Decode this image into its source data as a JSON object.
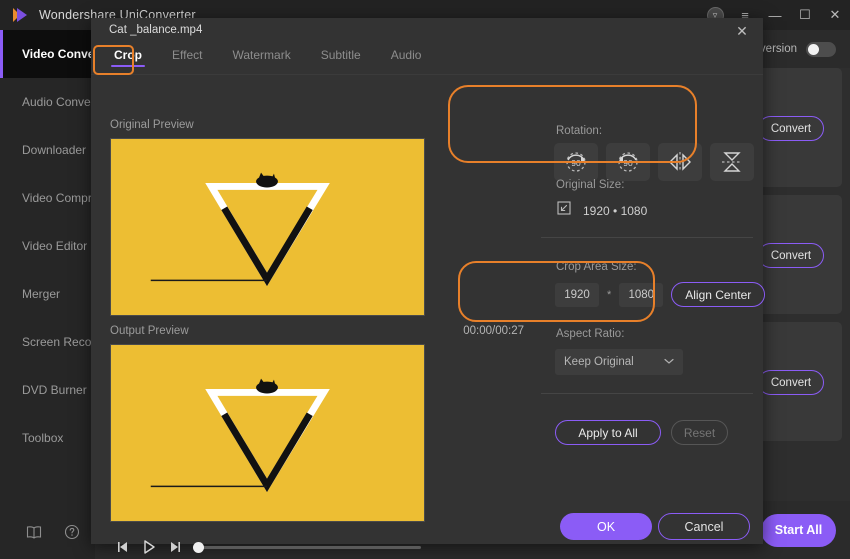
{
  "window": {
    "title": "Wondershare UniConverter",
    "controls": {
      "account": "account-icon",
      "menu": "≡",
      "minimize": "—",
      "maximize": "☐",
      "close": "✕"
    }
  },
  "sidebar": {
    "items": [
      {
        "label": "Video Converter",
        "active": true
      },
      {
        "label": "Audio Converter",
        "active": false
      },
      {
        "label": "Downloader",
        "active": false
      },
      {
        "label": "Video Compressor",
        "active": false
      },
      {
        "label": "Video Editor",
        "active": false
      },
      {
        "label": "Merger",
        "active": false
      },
      {
        "label": "Screen Recorder",
        "active": false
      },
      {
        "label": "DVD Burner",
        "active": false
      },
      {
        "label": "Toolbox",
        "active": false
      }
    ],
    "bottom": {
      "manual_icon": "book-icon",
      "help_icon": "help-icon"
    }
  },
  "main": {
    "merge_label": "Conversion",
    "merge_toggle_on": false,
    "rows": [
      {
        "convert_label": "Convert"
      },
      {
        "convert_label": "Convert"
      },
      {
        "convert_label": "Convert"
      }
    ],
    "start_all_label": "Start All"
  },
  "modal": {
    "file_name": "Cat _balance.mp4",
    "close_label": "✕",
    "tabs": [
      {
        "label": "Crop",
        "active": true
      },
      {
        "label": "Effect",
        "active": false
      },
      {
        "label": "Watermark",
        "active": false
      },
      {
        "label": "Subtitle",
        "active": false
      },
      {
        "label": "Audio",
        "active": false
      }
    ],
    "original_preview_label": "Original Preview",
    "output_preview_label": "Output Preview",
    "output_time": "00:00/00:27",
    "player": {
      "prev_frame_icon": "step-back-icon",
      "play_icon": "play-icon",
      "next_frame_icon": "step-forward-icon",
      "progress_percent": 0
    },
    "rotation": {
      "label": "Rotation:",
      "buttons": [
        {
          "name": "rotate-right-90",
          "text": "90"
        },
        {
          "name": "rotate-left-90",
          "text": "90"
        },
        {
          "name": "flip-horizontal",
          "text": ""
        },
        {
          "name": "flip-vertical",
          "text": ""
        }
      ]
    },
    "original_size": {
      "label": "Original Size:",
      "icon": "resize-icon",
      "value": "1920 • 1080"
    },
    "crop_area": {
      "label": "Crop Area Size:",
      "width": "1920",
      "separator": "*",
      "height": "1080",
      "align_center_label": "Align Center"
    },
    "aspect_ratio": {
      "label": "Aspect Ratio:",
      "selected": "Keep Original",
      "chevron": "chevron-down-icon"
    },
    "actions": {
      "apply_all_label": "Apply to All",
      "reset_label": "Reset",
      "ok_label": "OK",
      "cancel_label": "Cancel"
    }
  },
  "colors": {
    "accent_purple": "#8b5cf6",
    "highlight_orange": "#e8802a",
    "video_yellow": "#edbe33"
  }
}
